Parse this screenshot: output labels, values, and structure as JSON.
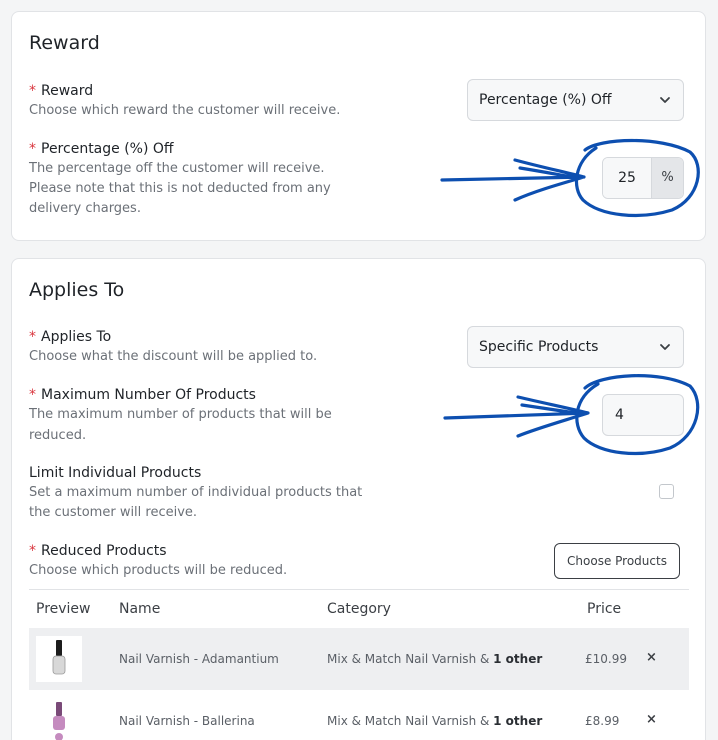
{
  "reward_section": {
    "title": "Reward",
    "reward_field": {
      "required_mark": "*",
      "label": "Reward",
      "help": "Choose which reward the customer will receive.",
      "selected": "Percentage (%) Off"
    },
    "percentage_field": {
      "required_mark": "*",
      "label": "Percentage (%) Off",
      "help_line1": "The percentage off the customer will receive.",
      "help_line2": "Please note that this is not deducted from any",
      "help_line3": "delivery charges.",
      "value": "25",
      "addon": "%"
    }
  },
  "applies_section": {
    "title": "Applies To",
    "applies_field": {
      "required_mark": "*",
      "label": "Applies To",
      "help": "Choose what the discount will be applied to.",
      "selected": "Specific Products"
    },
    "max_products_field": {
      "required_mark": "*",
      "label": "Maximum Number Of Products",
      "help_line1": "The maximum number of products that will be",
      "help_line2": "reduced.",
      "value": "4"
    },
    "limit_field": {
      "label": "Limit Individual Products",
      "help_line1": "Set a maximum number of individual products that",
      "help_line2": "the customer will receive.",
      "checked": false
    },
    "reduced_field": {
      "required_mark": "*",
      "label": "Reduced Products",
      "help": "Choose which products will be reduced.",
      "button": "Choose Products"
    },
    "table": {
      "headers": {
        "preview": "Preview",
        "name": "Name",
        "category": "Category",
        "price": "Price"
      },
      "rows": [
        {
          "name": "Nail Varnish - Adamantium",
          "category_prefix": "Mix & Match Nail Varnish & ",
          "category_more": "1 other",
          "price": "£10.99",
          "remove": "×",
          "thumb_color": "#1c1c1c"
        },
        {
          "name": "Nail Varnish - Ballerina",
          "category_prefix": "Mix & Match Nail Varnish & ",
          "category_more": "1 other",
          "price": "£8.99",
          "remove": "×",
          "thumb_color": "#c58bbf"
        }
      ]
    }
  },
  "colors": {
    "required": "#d9363e",
    "annotation": "#0d4fb0"
  }
}
